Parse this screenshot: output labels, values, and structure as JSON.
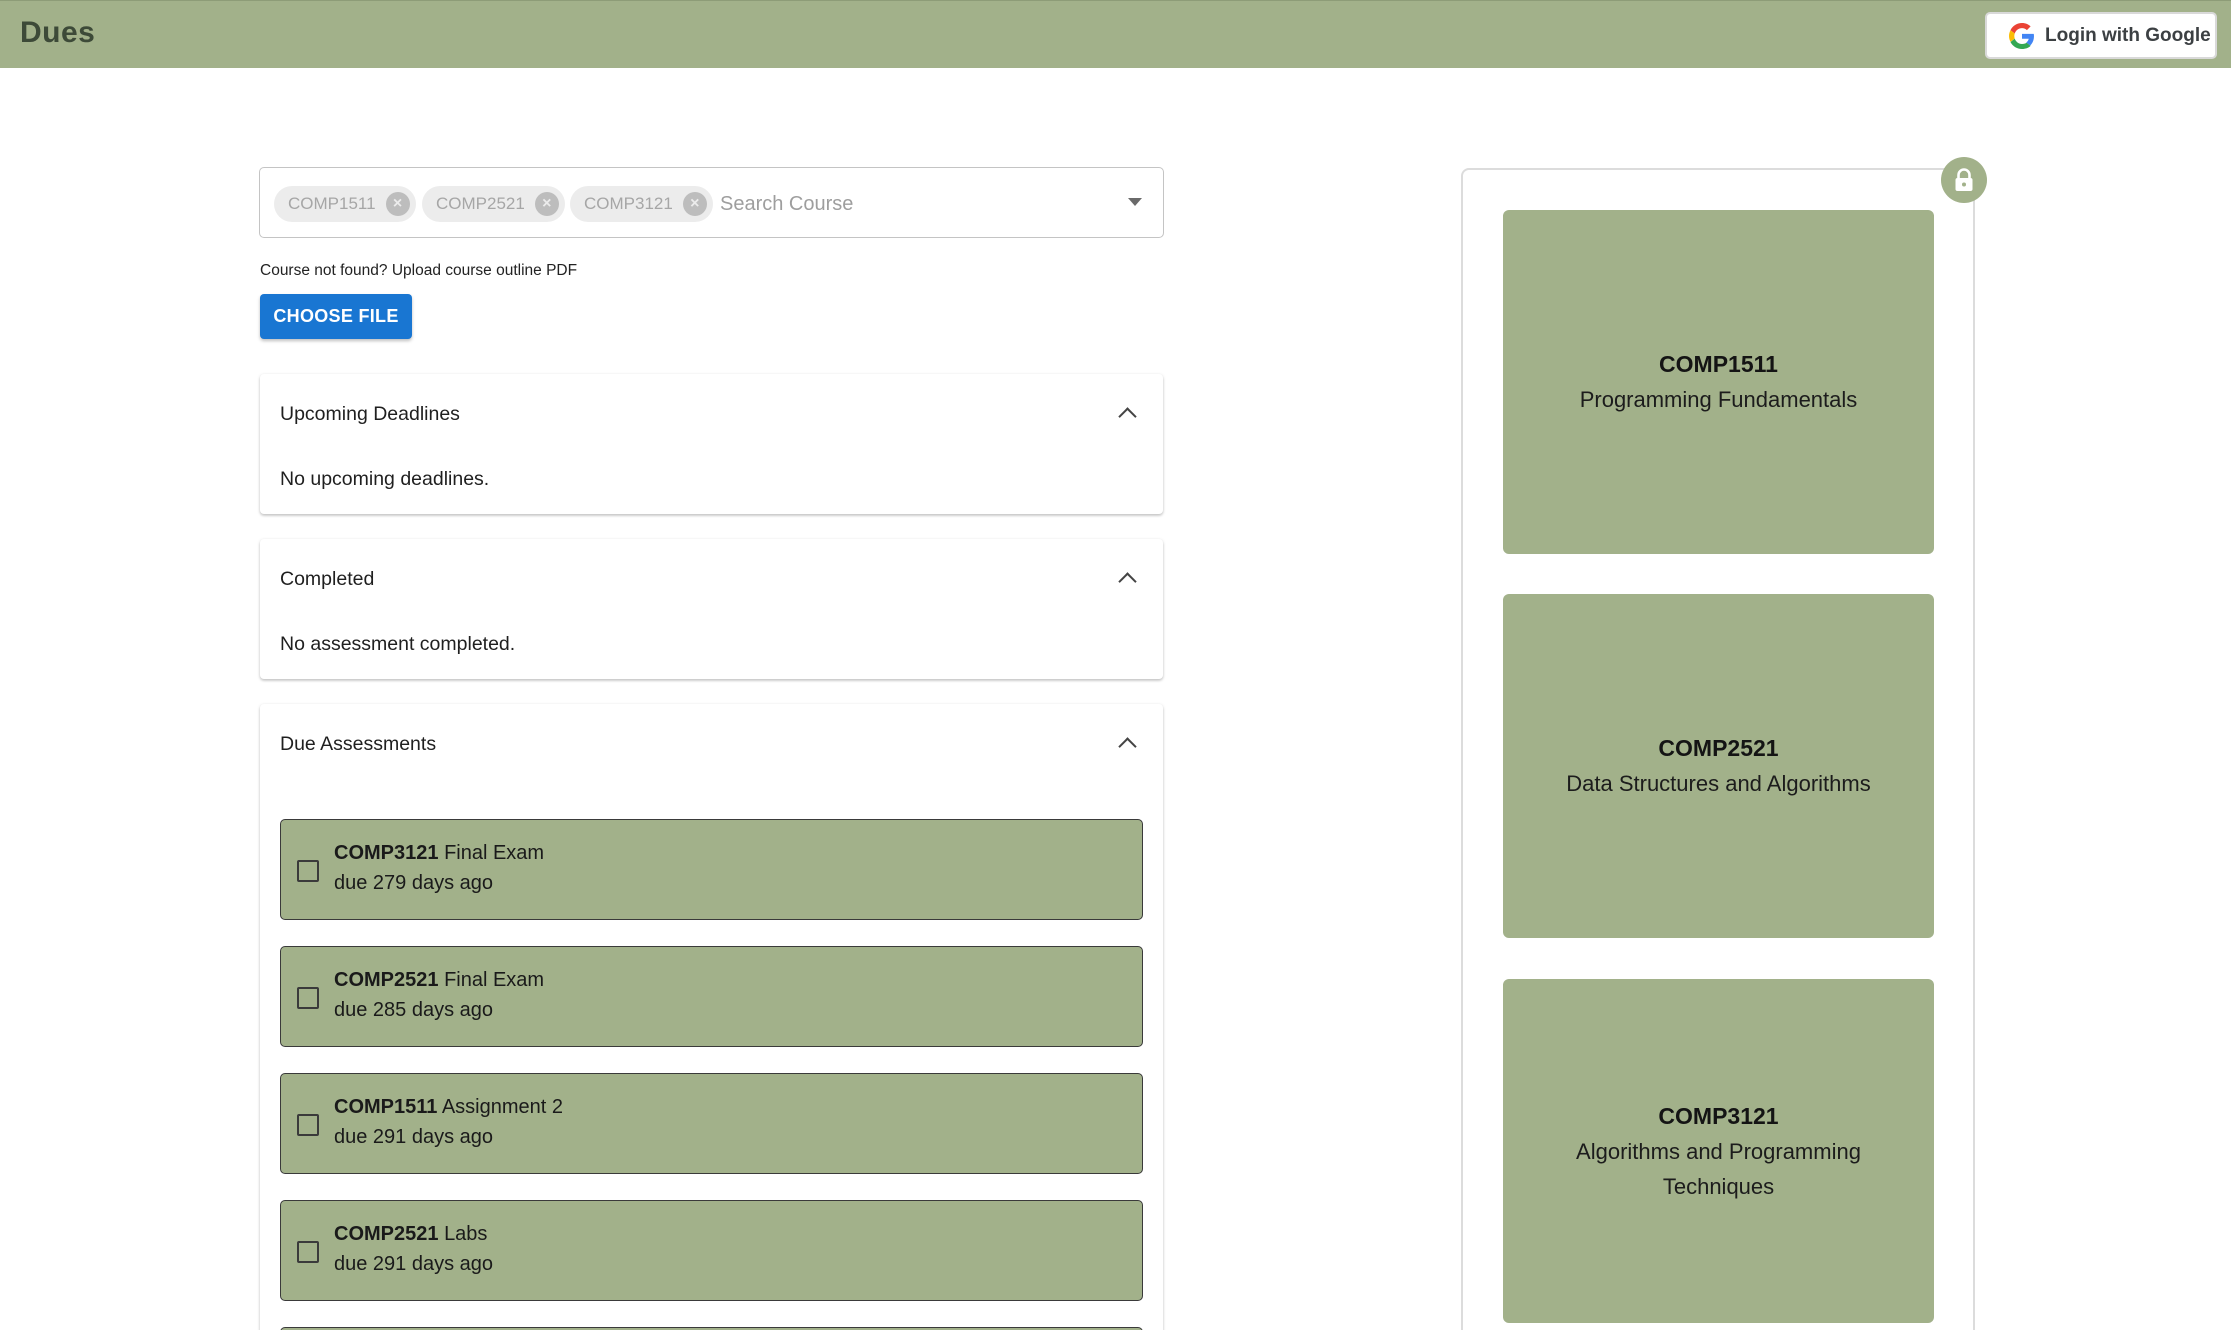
{
  "appbar": {
    "title": "Dues",
    "login_label": "Login with Google",
    "background": "#a2b18a"
  },
  "course_select": {
    "selected": [
      "COMP1511",
      "COMP2521",
      "COMP3121"
    ],
    "placeholder": "Search Course"
  },
  "upload": {
    "hint": "Course not found? Upload course outline PDF",
    "button_label": "CHOOSE FILE"
  },
  "sections": {
    "upcoming": {
      "title": "Upcoming Deadlines",
      "empty_text": "No upcoming deadlines."
    },
    "completed": {
      "title": "Completed",
      "empty_text": "No assessment completed."
    },
    "due": {
      "title": "Due Assessments"
    }
  },
  "due_items": [
    {
      "code": "COMP3121",
      "name": "Final Exam",
      "due": "due 279 days ago",
      "checked": false
    },
    {
      "code": "COMP2521",
      "name": "Final Exam",
      "due": "due 285 days ago",
      "checked": false
    },
    {
      "code": "COMP1511",
      "name": "Assignment 2",
      "due": "due 291 days ago",
      "checked": false
    },
    {
      "code": "COMP2521",
      "name": "Labs",
      "due": "due 291 days ago",
      "checked": false
    }
  ],
  "course_cards": [
    {
      "code": "COMP1511",
      "name": "Programming Fundamentals"
    },
    {
      "code": "COMP2521",
      "name": "Data Structures and Algorithms"
    },
    {
      "code": "COMP3121",
      "name": "Algorithms and Programming Techniques"
    }
  ],
  "icons": {
    "login": "google-icon",
    "lock": "lock-icon",
    "chip_remove": "cancel-circle-icon",
    "dropdown": "arrow-drop-down-icon",
    "section_toggle": "chevron-up-icon",
    "checkbox": "checkbox-blank-icon"
  },
  "colors": {
    "accent_green": "#a2b18a",
    "primary_button": "#1976d2"
  }
}
